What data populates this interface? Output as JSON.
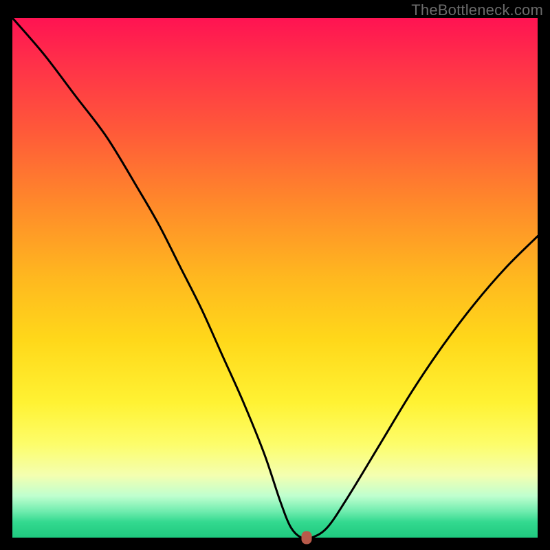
{
  "watermark": "TheBottleneck.com",
  "colors": {
    "frame": "#000000",
    "curve": "#000000",
    "dot": "#b85a4a",
    "gradient_stops": [
      "#ff1352",
      "#ff2e4a",
      "#ff5a39",
      "#ff8a2a",
      "#ffb81f",
      "#ffd81a",
      "#fff233",
      "#fdfd6a",
      "#f4ffb0",
      "#bfffcf",
      "#6eecae",
      "#33d98f",
      "#1fc97f"
    ]
  },
  "chart_data": {
    "type": "line",
    "title": "",
    "xlabel": "",
    "ylabel": "",
    "xlim": [
      0,
      100
    ],
    "ylim": [
      0,
      100
    ],
    "grid": false,
    "legend": false,
    "series": [
      {
        "name": "curve",
        "x": [
          0,
          6,
          12,
          18,
          24,
          28,
          32,
          36,
          40,
          44,
          48,
          51,
          53,
          55,
          57,
          60,
          64,
          70,
          76,
          82,
          88,
          94,
          100
        ],
        "values": [
          100,
          93,
          85,
          77,
          67,
          60,
          52,
          44,
          35,
          26,
          16,
          7,
          2,
          0,
          0,
          2,
          8,
          18,
          28,
          37,
          45,
          52,
          58
        ]
      }
    ],
    "marker": {
      "x": 56,
      "y": 0
    },
    "notes": "Background is a vertical rainbow/heat gradient from red (y=100) to green (y=0). The black curve dips to zero near x≈55–57 from both sides; a small rounded-rect marker sits at that minimum."
  }
}
